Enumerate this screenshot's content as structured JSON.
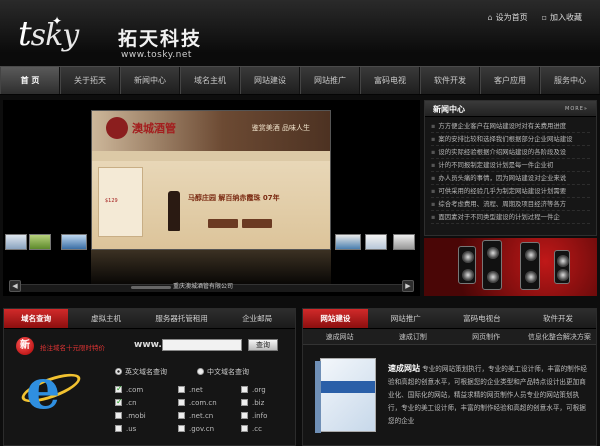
{
  "brand": {
    "mark": "tsky",
    "name_cn": "拓天科技",
    "url": "www.tosky.net"
  },
  "top_links": {
    "home": "设为首页",
    "fav": "加入收藏"
  },
  "nav": [
    "首 页",
    "关于拓天",
    "新闻中心",
    "域名主机",
    "网站建设",
    "网站推广",
    "富码电视",
    "软件开发",
    "客户应用",
    "服务中心"
  ],
  "banner": {
    "site_title": "澳城酒管",
    "tagline": "鉴赏美酒 品味人生",
    "product": "马醇庄园 解百纳赤霞珠 07年",
    "price": "$129",
    "caption": "重庆澳城酒管有限公司"
  },
  "news": {
    "title": "新闻中心",
    "more": "MORE»",
    "items": [
      "方方便企业客户在网站建设时对有关费用进度",
      "案的安排比较和选择我们根据部分企业网站建设",
      "设的实际经验根据介绍网站建设的各阶段及设",
      "计的不同报制定建设计划是每一件企业初",
      "办人员头痛的事情，因为网站建设对企业来说",
      "可供采用的经验几乎为制定网站建设计划需要",
      "综合考虑费用、流程、周期及项目经济等各方",
      "面因素对于不同类型建设的计划过程一件企"
    ]
  },
  "domain": {
    "tabs": [
      "域名查询",
      "虚拟主机",
      "服务器托管租用",
      "企业邮局"
    ],
    "xin": "新",
    "notice": "抢注域名十元限时特价",
    "www": "www.",
    "query_btn": "查询",
    "radio_en": "英文域名查询",
    "radio_cn": "中文域名查询",
    "tlds": [
      {
        "name": ".com",
        "checked": true
      },
      {
        "name": ".net",
        "checked": false
      },
      {
        "name": ".org",
        "checked": false
      },
      {
        "name": ".cn",
        "checked": true
      },
      {
        "name": ".com.cn",
        "checked": false
      },
      {
        "name": ".biz",
        "checked": false
      },
      {
        "name": ".mobi",
        "checked": false
      },
      {
        "name": ".net.cn",
        "checked": false
      },
      {
        "name": ".info",
        "checked": false
      },
      {
        "name": ".us",
        "checked": false
      },
      {
        "name": ".gov.cn",
        "checked": false
      },
      {
        "name": ".cc",
        "checked": false
      }
    ]
  },
  "build": {
    "tabs": [
      "网站建设",
      "网站推广",
      "富码电视台",
      "软件开发"
    ],
    "subtabs": [
      "速成网站",
      "速成订制",
      "网页制作",
      "信息化整合解决方案"
    ],
    "intro_title": "速成网站",
    "intro_text": "专业的网站策划执行，专业的美工设计师，丰富的制作经验和高超的创意水平，可根据您的企业类型和产品特点设计出更加商业化、国际化的网站，精益求精的网页制作人员专业的网站策划执行，专业的美工设计师，丰富的制作经验和高超的创意水平，可根据您的企业"
  }
}
